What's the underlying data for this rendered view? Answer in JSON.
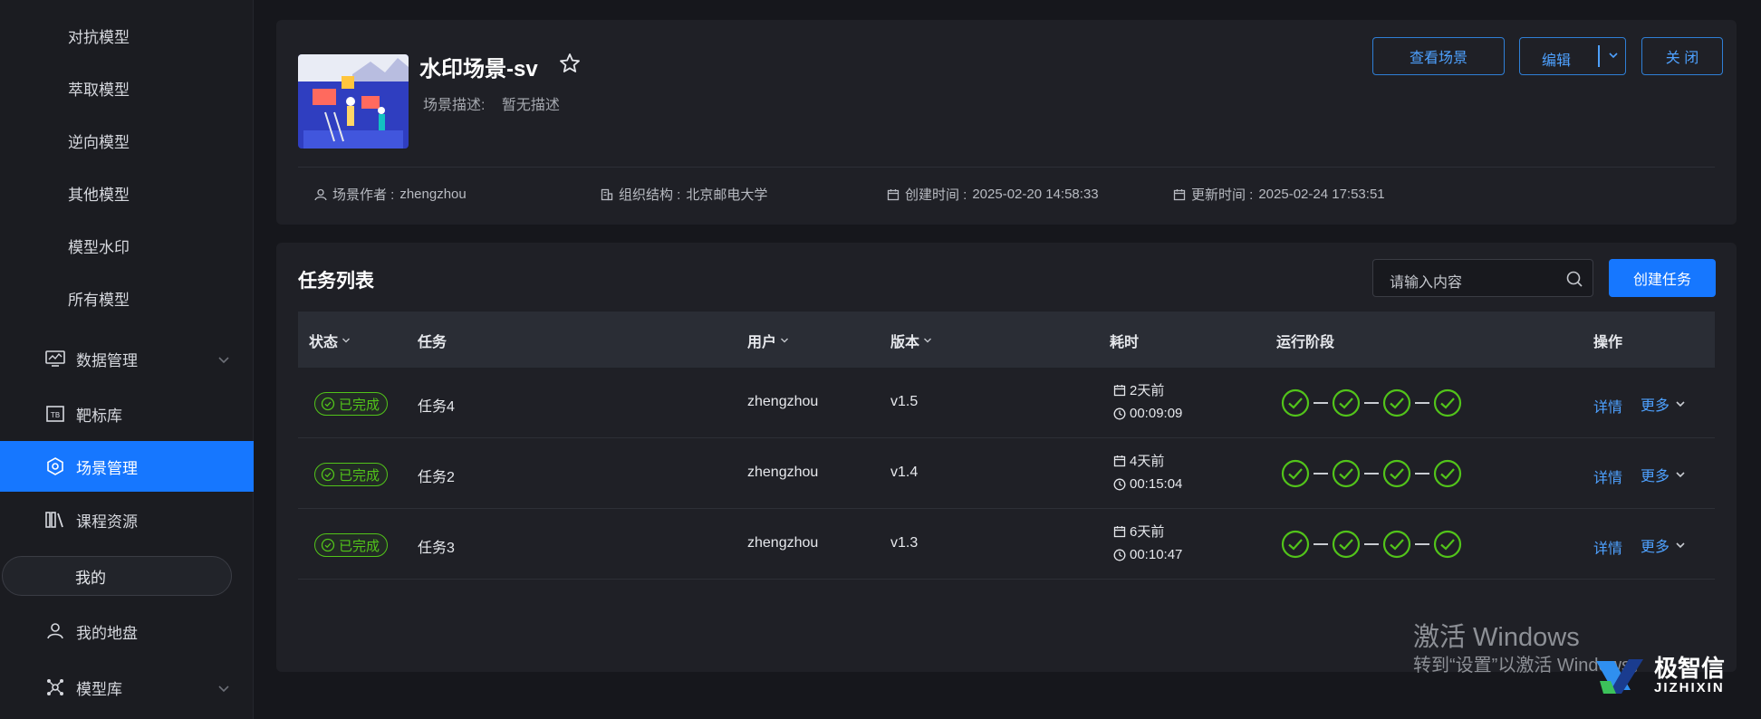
{
  "sidebar": {
    "sub_items": [
      {
        "label": "对抗模型"
      },
      {
        "label": "萃取模型"
      },
      {
        "label": "逆向模型"
      },
      {
        "label": "其他模型"
      },
      {
        "label": "模型水印"
      },
      {
        "label": "所有模型"
      }
    ],
    "data_mgmt": {
      "label": "数据管理"
    },
    "target_lib": {
      "label": "靶标库"
    },
    "scene_mgmt": {
      "label": "场景管理"
    },
    "course": {
      "label": "课程资源"
    },
    "mine": {
      "label": "我的"
    },
    "my_disk": {
      "label": "我的地盘"
    },
    "model_lib": {
      "label": "模型库"
    }
  },
  "scene": {
    "title": "水印场景-sv",
    "desc_label": "场景描述:",
    "desc_value": "暂无描述",
    "buttons": {
      "view": "查看场景",
      "edit": "编辑",
      "close": "关 闭"
    },
    "author_label": "场景作者 :",
    "author": "zhengzhou",
    "org_label": "组织结构 :",
    "org": "北京邮电大学",
    "created_label": "创建时间 :",
    "created": "2025-02-20 14:58:33",
    "updated_label": "更新时间 :",
    "updated": "2025-02-24 17:53:51"
  },
  "tasks": {
    "title": "任务列表",
    "search_placeholder": "请输入内容",
    "create_label": "创建任务",
    "columns": {
      "status": "状态",
      "task": "任务",
      "user": "用户",
      "version": "版本",
      "duration": "耗时",
      "stage": "运行阶段",
      "action": "操作"
    },
    "rows": [
      {
        "status": "已完成",
        "task": "任务4",
        "user": "zhengzhou",
        "version": "v1.5",
        "ago": "2天前",
        "duration": "00:09:09",
        "detail": "详情",
        "more": "更多"
      },
      {
        "status": "已完成",
        "task": "任务2",
        "user": "zhengzhou",
        "version": "v1.4",
        "ago": "4天前",
        "duration": "00:15:04",
        "detail": "详情",
        "more": "更多"
      },
      {
        "status": "已完成",
        "task": "任务3",
        "user": "zhengzhou",
        "version": "v1.3",
        "ago": "6天前",
        "duration": "00:10:47",
        "detail": "详情",
        "more": "更多"
      }
    ]
  },
  "watermark": {
    "line1": "激活 Windows",
    "line2": "转到“设置”以激活 Windows。",
    "logo_cn": "极智信",
    "logo_en": "JIZHIXIN"
  },
  "colors": {
    "accent": "#1677ff",
    "success": "#52c41a",
    "link": "#4ea1ff"
  }
}
